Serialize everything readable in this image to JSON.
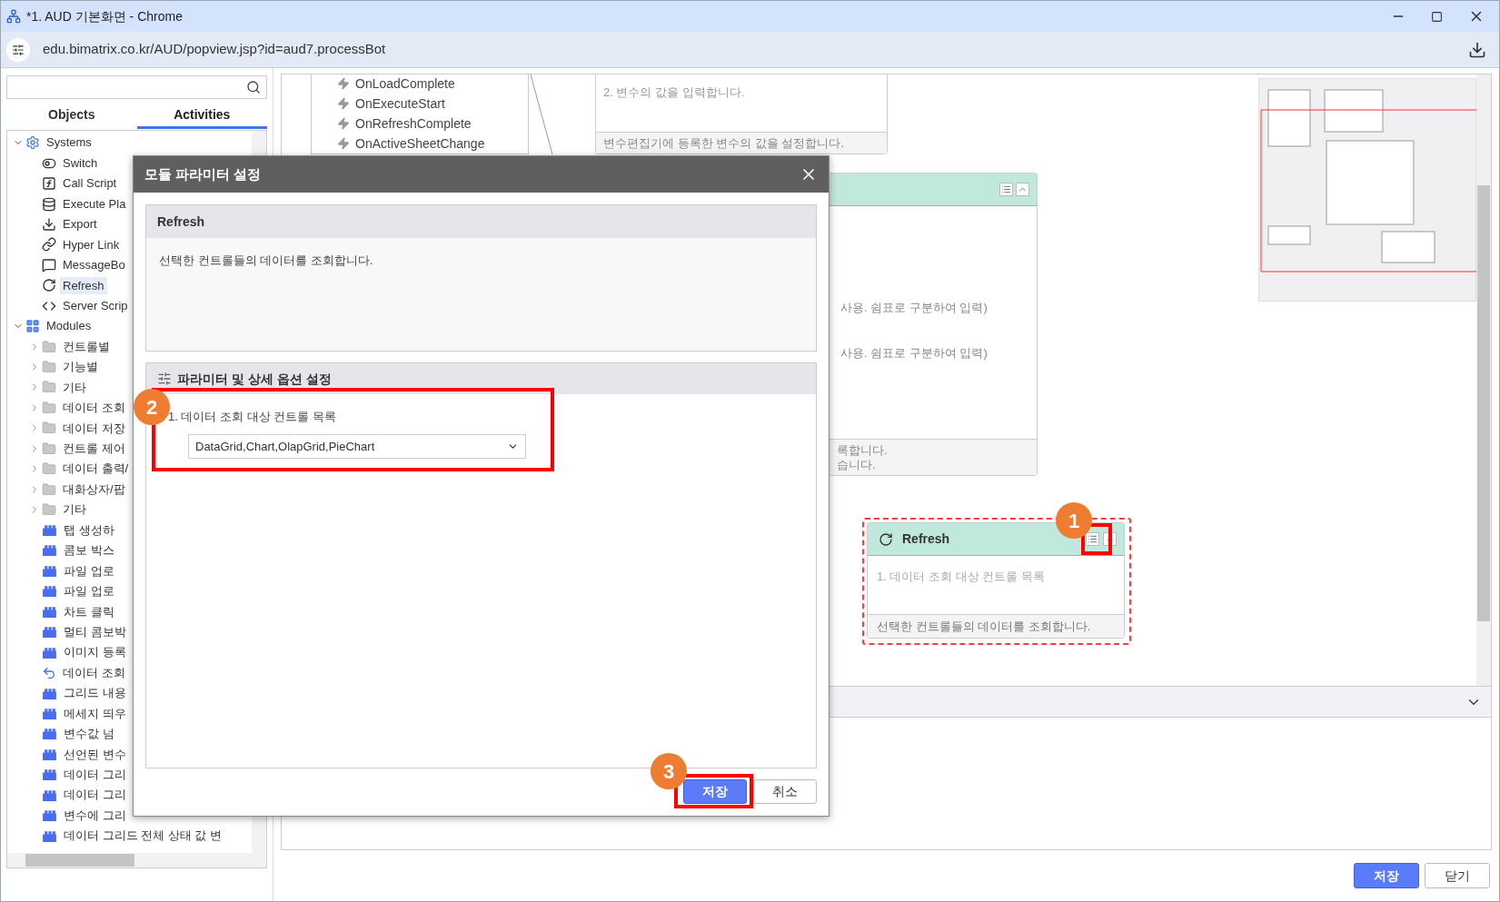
{
  "window": {
    "title": "*1. AUD 기본화면 - Chrome",
    "url": "edu.bimatrix.co.kr/AUD/popview.jsp?id=aud7.processBot"
  },
  "sidebar": {
    "tabs": [
      {
        "label": "Objects",
        "selected": false
      },
      {
        "label": "Activities",
        "selected": true
      }
    ],
    "tree": [
      {
        "label": "Systems",
        "kind": "gear",
        "expanded": true,
        "selected": false,
        "children": [
          {
            "label": "Switch",
            "kind": "toggle",
            "selected": false
          },
          {
            "label": "Call Script",
            "kind": "function",
            "selected": false
          },
          {
            "label": "Execute Pla",
            "kind": "database",
            "selected": false
          },
          {
            "label": "Export",
            "kind": "download",
            "selected": false
          },
          {
            "label": "Hyper Link",
            "kind": "link",
            "selected": false
          },
          {
            "label": "MessageBo",
            "kind": "message",
            "selected": false
          },
          {
            "label": "Refresh",
            "kind": "refresh",
            "selected": true
          },
          {
            "label": "Server Scrip",
            "kind": "code",
            "selected": false
          }
        ]
      },
      {
        "label": "Modules",
        "kind": "grid",
        "expanded": true,
        "selected": false,
        "children": [
          {
            "label": "컨트롤별",
            "kind": "folder",
            "expanded": false,
            "selected": false
          },
          {
            "label": "기능별",
            "kind": "folder",
            "expanded": false,
            "selected": false
          },
          {
            "label": "기타",
            "kind": "folder",
            "expanded": false,
            "selected": false
          },
          {
            "label": "데이터 조회",
            "kind": "folder",
            "expanded": false,
            "selected": false
          },
          {
            "label": "데이터 저장",
            "kind": "folder",
            "expanded": false,
            "selected": false
          },
          {
            "label": "컨트롤 제어",
            "kind": "folder",
            "expanded": false,
            "selected": false
          },
          {
            "label": "데이터 출력/",
            "kind": "folder",
            "expanded": false,
            "selected": false
          },
          {
            "label": "대화상자/팝",
            "kind": "folder",
            "expanded": false,
            "selected": false
          },
          {
            "label": "기타",
            "kind": "folder",
            "expanded": false,
            "selected": false
          },
          {
            "label": "탭 생성하",
            "kind": "module",
            "selected": false
          },
          {
            "label": "콤보 박스",
            "kind": "module",
            "selected": false
          },
          {
            "label": "파일 업로",
            "kind": "module",
            "selected": false
          },
          {
            "label": "파일 업로",
            "kind": "module",
            "selected": false
          },
          {
            "label": "차트 클릭",
            "kind": "module",
            "selected": false
          },
          {
            "label": "멀티 콤보박",
            "kind": "module",
            "selected": false
          },
          {
            "label": "이미지 등록",
            "kind": "module",
            "selected": false
          },
          {
            "label": "데이터 조회",
            "kind": "module-refresh",
            "selected": false
          },
          {
            "label": "그리드 내용",
            "kind": "module",
            "selected": false
          },
          {
            "label": "메세지 띄우",
            "kind": "module",
            "selected": false
          },
          {
            "label": "변수값 넘",
            "kind": "module",
            "selected": false
          },
          {
            "label": "선언된 변수",
            "kind": "module",
            "selected": false
          },
          {
            "label": "데이터 그리",
            "kind": "module",
            "selected": false
          },
          {
            "label": "데이터 그리",
            "kind": "module",
            "selected": false
          },
          {
            "label": "변수에 그리",
            "kind": "module",
            "selected": false
          },
          {
            "label": "데이터 그리드 전체 상태 값 변",
            "kind": "module",
            "selected": false
          }
        ]
      }
    ]
  },
  "canvas": {
    "events": [
      "OnLoadComplete",
      "OnExecuteStart",
      "OnRefreshComplete",
      "OnActiveSheetChange"
    ],
    "variable_node": {
      "param": "2. 변수의 값을 입력합니다.",
      "footer": "변수편집기에 등록한 변수의 값을 설정합니다."
    },
    "partial_node": {
      "lines": [
        "사용. 쉼표로 구분하여 입력)",
        "사용. 쉼표로 구분하여 입력)"
      ],
      "footer_lines": [
        "록합니다.",
        "습니다."
      ]
    },
    "refresh_node": {
      "title": "Refresh",
      "param": "1. 데이터 조회 대상 컨트롤 목록",
      "footer": "선택한 컨트롤들의 데이터를 조회합니다.",
      "selected": true
    }
  },
  "dialog": {
    "title": "모듈 파라미터 설정",
    "module": {
      "title": "Refresh",
      "description": "선택한 컨트롤들의 데이터를 조회합니다."
    },
    "params_title": "파라미터 및 상세 옵션 설정",
    "param": {
      "label": "1. 데이터 조회 대상 컨트롤 목록",
      "value": "DataGrid,Chart,OlapGrid,PieChart"
    },
    "buttons": [
      {
        "label": "저장",
        "kind": "primary"
      },
      {
        "label": "취소",
        "kind": "secondary"
      }
    ]
  },
  "annotations": [
    "1",
    "2",
    "3"
  ],
  "footer_buttons": [
    {
      "label": "저장",
      "kind": "primary"
    },
    {
      "label": "닫기",
      "kind": "secondary"
    }
  ]
}
